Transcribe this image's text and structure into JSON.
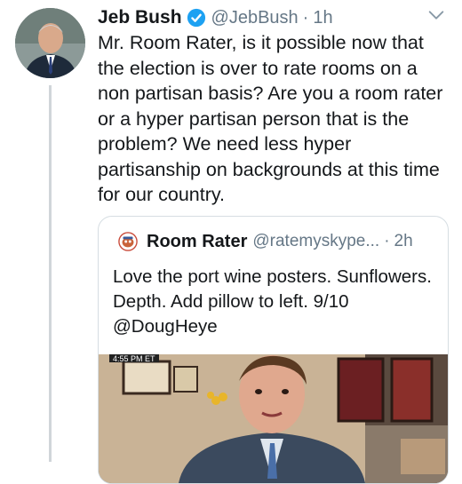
{
  "tweet": {
    "author_name": "Jeb Bush",
    "handle": "@JebBush",
    "separator": "·",
    "time": "1h",
    "text": "Mr. Room Rater, is it possible now that the election is over to rate rooms on a non partisan basis? Are you a room rater or a hyper partisan person that is the problem? We need less hyper partisanship on backgrounds at this time for our country.",
    "verified_icon": "verified-badge-icon",
    "menu_icon": "chevron-down-icon"
  },
  "quoted": {
    "author_name": "Room Rater",
    "handle": "@ratemyskype...",
    "separator": "·",
    "time": "2h",
    "text": "Love the port wine posters. Sunflowers. Depth. Add pillow to left. 9/10 @DougHeye",
    "media_timestamp": "4:55 PM ET"
  },
  "colors": {
    "verified": "#1da1f2",
    "secondary_text": "#657786",
    "border": "#d6dde2"
  }
}
